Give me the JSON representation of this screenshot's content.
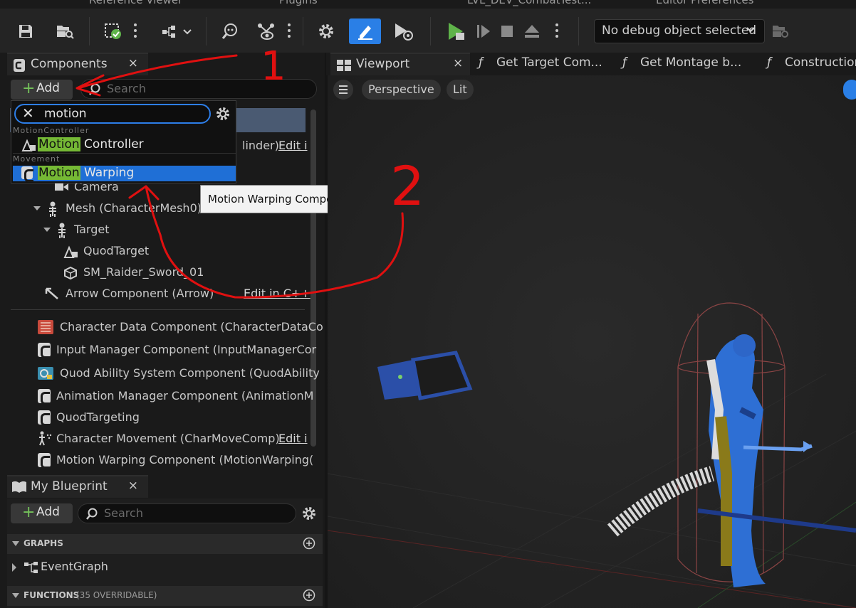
{
  "top_strip": {
    "items": [
      "Reference Viewer",
      "Plugins",
      "LVL_DEV_CombatTest...",
      "Editor Preferences"
    ]
  },
  "toolbar": {
    "icons": [
      "save-icon",
      "browse-icon",
      "compile-icon",
      "diff-icon",
      "find-icon",
      "debug-filter-icon",
      "settings-icon",
      "edit-defaults-icon",
      "simulation-icon",
      "play-icon",
      "step-icon",
      "stop-icon",
      "eject-icon"
    ],
    "debug_object": "No debug object selected"
  },
  "components_panel": {
    "title": "Components",
    "close": "×",
    "add_label": "Add",
    "search_placeholder": "Search",
    "dropdown": {
      "query": "motion",
      "categories": [
        {
          "name": "MotionController",
          "items": [
            {
              "match": "Motion",
              "rest": " Controller",
              "selected": false
            }
          ]
        },
        {
          "name": "Movement",
          "items": [
            {
              "match": "Motion",
              "rest": " Warping",
              "selected": true
            }
          ]
        }
      ]
    },
    "tooltip": "Motion Warping Component",
    "tree": [
      {
        "label": "linder)",
        "edit": "Edit i"
      },
      {
        "label": "Camera"
      },
      {
        "label": "Mesh (CharacterMesh0)"
      },
      {
        "label": "Target"
      },
      {
        "label": "QuodTarget"
      },
      {
        "label": "SM_Raider_Sword_01"
      },
      {
        "label": "Arrow Component (Arrow)",
        "edit": "Edit in C++"
      }
    ],
    "components": [
      {
        "label": "Character Data Component (CharacterDataCo",
        "icon": "data-book-icon"
      },
      {
        "label": "Input Manager Component (InputManagerCor",
        "icon": "class-icon"
      },
      {
        "label": "Quod Ability System Component (QuodAbility",
        "icon": "ability-icon"
      },
      {
        "label": "Animation Manager Component (AnimationM",
        "icon": "class-icon"
      },
      {
        "label": "QuodTargeting",
        "icon": "class-icon"
      },
      {
        "label": "Character Movement (CharMoveComp)",
        "icon": "movement-icon",
        "edit": "Edit i"
      },
      {
        "label": "Motion Warping Component (MotionWarping(",
        "icon": "class-icon"
      }
    ]
  },
  "blueprint_panel": {
    "title": "My Blueprint",
    "close": "×",
    "add_label": "Add",
    "search_placeholder": "Search",
    "graphs_label": "GRAPHS",
    "event_graph": "EventGraph",
    "functions_label": "FUNCTIONS",
    "functions_note": "(35 OVERRIDABLE)"
  },
  "viewport": {
    "tabs": [
      {
        "label": "Viewport",
        "close": "×"
      },
      {
        "label": "Get Target Com..."
      },
      {
        "label": "Get Montage b..."
      },
      {
        "label": "Construction"
      }
    ],
    "perspective": "Perspective",
    "lit": "Lit"
  },
  "annotations": {
    "mark_1": "1",
    "mark_2": "2",
    "color": "#e01010"
  }
}
